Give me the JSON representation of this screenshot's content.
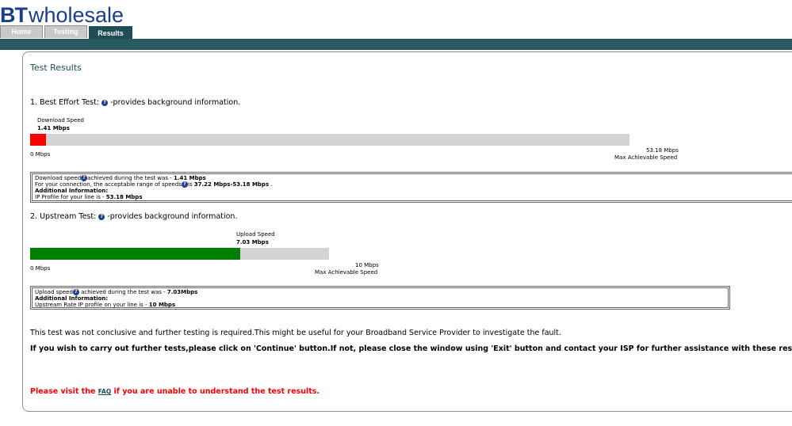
{
  "header": {
    "logo_bt": "BT",
    "logo_wholesale": "wholesale",
    "tabs": [
      {
        "label": "Home"
      },
      {
        "label": "Testing"
      },
      {
        "label": "Results"
      }
    ],
    "active_tab": "Results"
  },
  "panel": {
    "title": "Test Results"
  },
  "best_effort": {
    "heading_prefix": "1. Best Effort Test:",
    "heading_suffix": " -provides background information.",
    "bar_label": "Download Speed",
    "speed_value": "1.41 Mbps",
    "min_label": "0 Mbps",
    "max_value": "53.18 Mbps",
    "max_label": "Max Achievable Speed",
    "fill_fraction": 0.0265,
    "fill_color": "#ff0000",
    "info": {
      "line1_prefix": "Download speed",
      "line1_mid": "achieved during the test was - ",
      "line1_value": "1.41 Mbps",
      "line2_prefix": "For your connection, the acceptable range of speeds",
      "line2_mid": "is ",
      "line2_value": "37.22 Mbps-53.18 Mbps",
      "line2_suffix": " .",
      "line3": "Additional Information:",
      "line4_prefix": "IP Profile for your line is - ",
      "line4_value": "53.18 Mbps"
    }
  },
  "upstream": {
    "heading_prefix": "2. Upstream Test:",
    "heading_suffix": " -provides background information.",
    "bar_label": "Upload Speed",
    "speed_value": "7.03 Mbps",
    "min_label": "0 Mbps",
    "max_value": "10 Mbps",
    "max_label": "Max Achievable Speed",
    "fill_fraction": 0.703,
    "fill_color": "#008000",
    "info": {
      "line1_prefix": "Upload speed",
      "line1_mid": " achieved during the test was - ",
      "line1_value": "7.03Mbps",
      "line2": "Additional Information:",
      "line3_prefix": "Upstream Rate IP profile on your line is - ",
      "line3_value": "10 Mbps"
    }
  },
  "messages": {
    "inconclusive": "This test was not conclusive and further testing is required.This might be useful for your Broadband Service Provider to investigate the fault.",
    "instructions": "If you wish to carry out further tests,please click on 'Continue' button.If not, please close the window using 'Exit' button and contact your ISP for further assistance with these results.",
    "faq_prefix": "Please visit the ",
    "faq_link": "FAQ",
    "faq_suffix": " if you are unable to understand the test results."
  },
  "icons": {
    "help": "help-icon"
  }
}
